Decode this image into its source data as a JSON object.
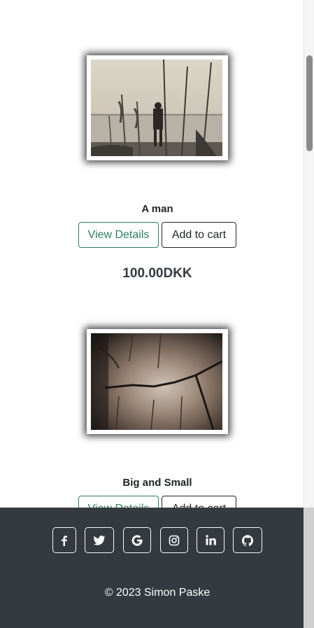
{
  "products": [
    {
      "name": "A man",
      "image_alt": "man-by-the-sea-photo",
      "view_details_label": "View Details",
      "add_to_cart_label": "Add to cart",
      "price": "100.00DKK"
    },
    {
      "name": "Big and Small",
      "image_alt": "tree-bark-photo",
      "view_details_label": "View Details",
      "add_to_cart_label": "Add to cart"
    }
  ],
  "footer": {
    "social_icons": [
      "facebook-icon",
      "twitter-icon",
      "google-icon",
      "instagram-icon",
      "linkedin-icon",
      "github-icon"
    ],
    "copyright": "© 2023 Simon Paske"
  },
  "colors": {
    "accent_green": "#2e7d5b",
    "footer_bg": "#343a40",
    "text_dark": "#212529"
  }
}
